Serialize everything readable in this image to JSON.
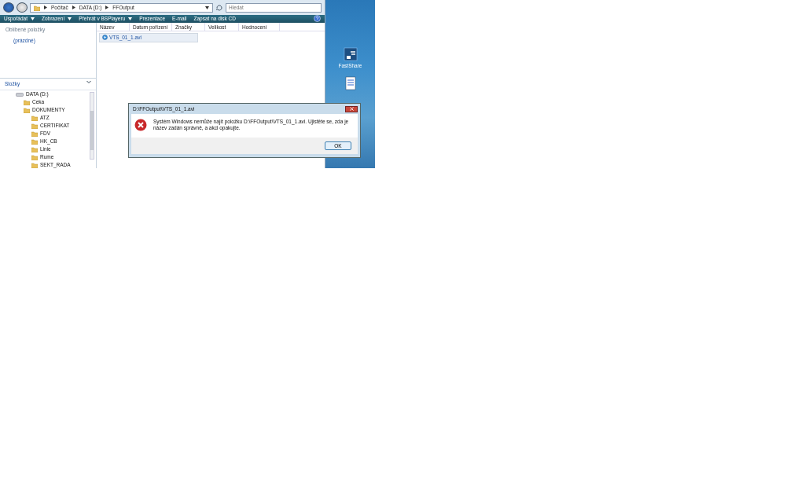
{
  "address_bar": {
    "breadcrumb": [
      "Počítač",
      "DATA (D:)",
      "FFOutput"
    ],
    "search": {
      "placeholder": "Hledat"
    }
  },
  "toolbar": {
    "items": [
      {
        "label": "Uspořádat",
        "dropdown": true
      },
      {
        "label": "Zobrazení",
        "dropdown": true
      },
      {
        "label": "Přehrát v BSPlayeru",
        "dropdown": true
      },
      {
        "label": "Prezentace",
        "dropdown": false
      },
      {
        "label": "E-mail",
        "dropdown": false
      },
      {
        "label": "Zapsat na disk CD",
        "dropdown": false
      }
    ]
  },
  "favorites": {
    "title": "Oblíbené položky",
    "items": [
      "(prázdné)"
    ]
  },
  "folders": {
    "title": "Složky",
    "tree": [
      {
        "label": "DATA (D:)",
        "kind": "drive",
        "children": [
          {
            "label": "Ceka",
            "kind": "folder"
          },
          {
            "label": "DOKUMENTY",
            "kind": "folder",
            "children": [
              {
                "label": "ATZ",
                "kind": "folder"
              },
              {
                "label": "CERTIFIKAT",
                "kind": "folder"
              },
              {
                "label": "FDV",
                "kind": "folder"
              },
              {
                "label": "HK_CB",
                "kind": "folder"
              },
              {
                "label": "Linie",
                "kind": "folder"
              },
              {
                "label": "Rume",
                "kind": "folder"
              },
              {
                "label": "SEKT_RADA",
                "kind": "folder"
              }
            ]
          }
        ]
      }
    ]
  },
  "file_list": {
    "columns": [
      "Název",
      "Datum pořízení",
      "Značky",
      "Velikost",
      "Hodnocení"
    ],
    "rows": [
      {
        "name": "VTS_01_1.avi",
        "selected": true
      }
    ]
  },
  "desktop": {
    "icons": [
      {
        "label": "FastShare"
      }
    ]
  },
  "dialog": {
    "title": "D:\\FFOutput\\VTS_01_1.avi",
    "message": "Systém Windows nemůže najít položku D:\\FFOutput\\VTS_01_1.avi. Ujistěte se, zda je název zadán správně, a akci opakujte.",
    "buttons": [
      "OK"
    ]
  }
}
